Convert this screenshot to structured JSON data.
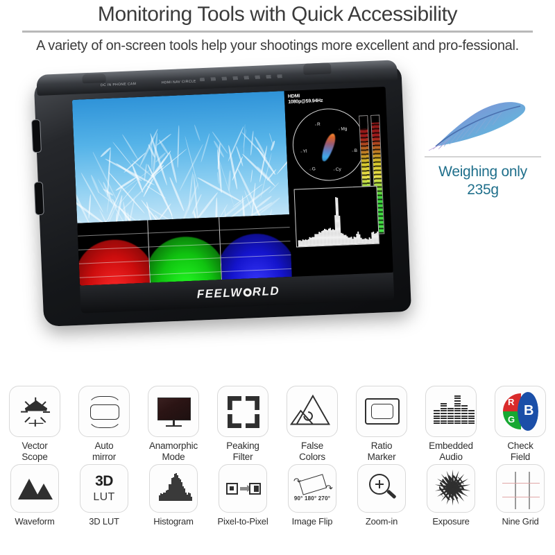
{
  "header": {
    "title": "Monitoring Tools with Quick Accessibility",
    "subtitle": "A variety of on-screen tools help your shootings more excellent and pro-fessional."
  },
  "product": {
    "brand": "FEELW",
    "brand_suffix": "RLD",
    "top_labels": {
      "left": "DC IN  PHONE  CAM",
      "center": "HDMI  NAV  CIRCLE"
    },
    "screen_osd": {
      "input": "HDMI",
      "format": "1080p@59.94Hz",
      "vectorscope_labels": [
        "R",
        "Mg",
        "B",
        "Cy",
        "G",
        "Yl"
      ]
    }
  },
  "weight_callout": {
    "line1": "Weighing only",
    "line2": "235g",
    "color": "#1f6f8b",
    "icon": "feather-icon"
  },
  "features": {
    "row1": [
      {
        "label_line1": "Vector",
        "label_line2": "Scope",
        "icon": "vector-scope-icon"
      },
      {
        "label_line1": "Auto",
        "label_line2": "mirror",
        "icon": "auto-mirror-icon"
      },
      {
        "label_line1": "Anamorphic",
        "label_line2": "Mode",
        "icon": "anamorphic-mode-icon"
      },
      {
        "label_line1": "Peaking",
        "label_line2": "Filter",
        "icon": "peaking-filter-icon"
      },
      {
        "label_line1": "False",
        "label_line2": "Colors",
        "icon": "false-colors-icon"
      },
      {
        "label_line1": "Ratio",
        "label_line2": "Marker",
        "icon": "ratio-marker-icon"
      },
      {
        "label_line1": "Embedded",
        "label_line2": "Audio",
        "icon": "embedded-audio-icon"
      },
      {
        "label_line1": "Check",
        "label_line2": "Field",
        "icon": "check-field-icon"
      }
    ],
    "row2": [
      {
        "label_line1": "Waveform",
        "label_line2": "",
        "icon": "waveform-icon"
      },
      {
        "label_line1": "3D LUT",
        "label_line2": "",
        "icon": "three-d-lut-icon"
      },
      {
        "label_line1": "Histogram",
        "label_line2": "",
        "icon": "histogram-icon"
      },
      {
        "label_line1": "Pixel-to-Pixel",
        "label_line2": "",
        "icon": "pixel-to-pixel-icon"
      },
      {
        "label_line1": "Image Flip",
        "label_line2": "",
        "icon": "image-flip-icon"
      },
      {
        "label_line1": "Zoom-in",
        "label_line2": "",
        "icon": "zoom-in-icon"
      },
      {
        "label_line1": "Exposure",
        "label_line2": "",
        "icon": "exposure-icon"
      },
      {
        "label_line1": "Nine Grid",
        "label_line2": "",
        "icon": "nine-grid-icon"
      }
    ]
  },
  "icon_text": {
    "lut_3d": "3D",
    "lut_word": "LUT",
    "check_field_r": "R",
    "check_field_g": "G",
    "check_field_b": "B",
    "image_flip_angles": "90° 180° 270°"
  },
  "colors": {
    "accent_teal": "#1f6f8b",
    "red": "#d92b2b",
    "green": "#17a832",
    "blue": "#1b4fa8",
    "icon_dark": "#2f2f2f",
    "box_border": "#d8d8d8"
  }
}
